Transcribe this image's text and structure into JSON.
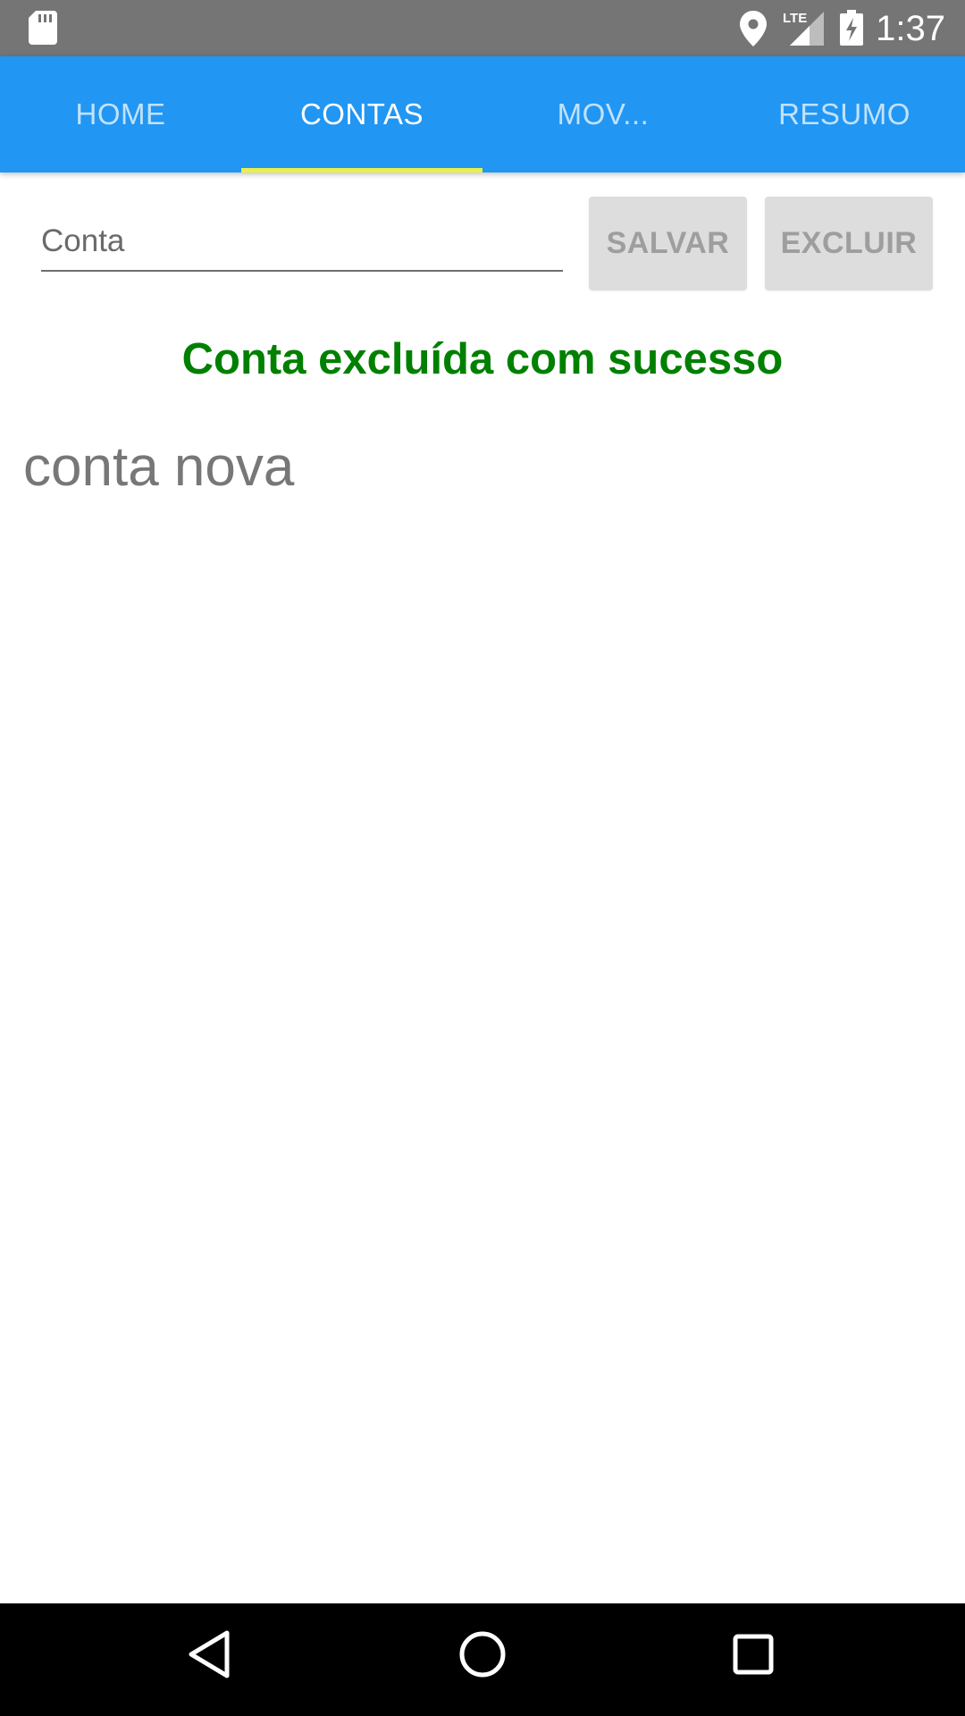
{
  "status_bar": {
    "time": "1:37",
    "network_label": "LTE",
    "icons": [
      "sd-card-icon",
      "location-icon",
      "signal-icon",
      "battery-charging-icon"
    ]
  },
  "tabs": [
    {
      "label": "HOME",
      "active": false
    },
    {
      "label": "CONTAS",
      "active": true
    },
    {
      "label": "MOV...",
      "active": false
    },
    {
      "label": "RESUMO",
      "active": false
    }
  ],
  "form": {
    "conta_placeholder": "Conta",
    "conta_value": "",
    "save_label": "SALVAR",
    "delete_label": "EXCLUIR"
  },
  "message": "Conta excluída com sucesso",
  "list": {
    "items": [
      "conta nova"
    ]
  },
  "nav_bar": {
    "icons": [
      "back-icon",
      "home-icon",
      "recents-icon"
    ]
  },
  "colors": {
    "app_bar": "#2196f3",
    "tab_indicator": "#e8f04a",
    "success": "#008000",
    "status_bar": "#757575"
  }
}
